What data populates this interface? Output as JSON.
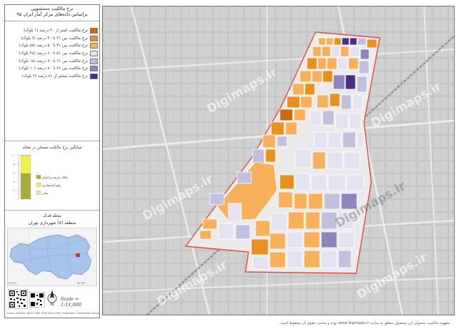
{
  "legend": {
    "title_line1": "نرخ مالکیت دستشویی",
    "title_line2": "براساس داده‌های مرکز آمار ایران ۹۵",
    "items": [
      {
        "label": "نرخ مالکیت کمتر از ۳۰ درصد (۱ بلوک)",
        "color": "#c86a0f"
      },
      {
        "label": "نرخ مالکیت بین ۳۱ تا ۴۰ درصد (۷ بلوک)",
        "color": "#e8911c"
      },
      {
        "label": "نرخ مالکیت بین ۴۱ تا ۵۰ درصد (۵۸ بلوک)",
        "color": "#f6b15a"
      },
      {
        "label": "نرخ مالکیت بین ۵۱ تا ۶۰ درصد (۴۸ بلوک)",
        "color": "#e6e3f0"
      },
      {
        "label": "نرخ مالکیت بین ۶۱ تا ۷۰ درصد (۱۸ بلوک)",
        "color": "#c3c0de"
      },
      {
        "label": "نرخ مالکیت بین ۷۱ تا ۸۰ درصد (۱۰ بلوک)",
        "color": "#8d84c0"
      },
      {
        "label": "نرخ مالکیت بیشتر از ۸۱ درصد (۳ بلوک)",
        "color": "#4b2e83"
      }
    ]
  },
  "chart": {
    "title": "میانگین نرخ مالکیت مسکن در محله",
    "tick_labels": [
      "۱۰۰",
      "۸۰",
      "۶۰",
      "۴۰",
      "۲۰",
      "۰"
    ],
    "series": [
      {
        "label": "مالک عرصه و اعیان",
        "color": "#a6ad3a"
      },
      {
        "label": "رهن/استیجاری",
        "color": "#f2ee4d"
      },
      {
        "label": "سایر",
        "color": "#fbd99a"
      }
    ]
  },
  "chart_data": {
    "type": "bar",
    "stacked": true,
    "title": "میانگین نرخ مالکیت مسکن در محله",
    "categories": [
      ""
    ],
    "series": [
      {
        "name": "مالک عرصه و اعیان",
        "values": [
          58
        ]
      },
      {
        "name": "رهن/استیجاری",
        "values": [
          40
        ]
      },
      {
        "name": "سایر",
        "values": [
          2
        ]
      }
    ],
    "ylim": [
      0,
      100
    ]
  },
  "neighborhood": {
    "title": "محله فدک",
    "subtitle": "منطقه (۸) شهرداری تهران"
  },
  "scale": "Scale = 1:11,000",
  "north": "N",
  "credit": "Coord. System: WGS 1984 UTM Zone 39N | Projection: Transverse Mercator",
  "watermark": "Digimaps.ir",
  "footer": "مفهوم مالکیت، محتوای این محصول متعلق به سایت www.digimaps.ir بوده و تمامی حقوق آن محفوظ است."
}
